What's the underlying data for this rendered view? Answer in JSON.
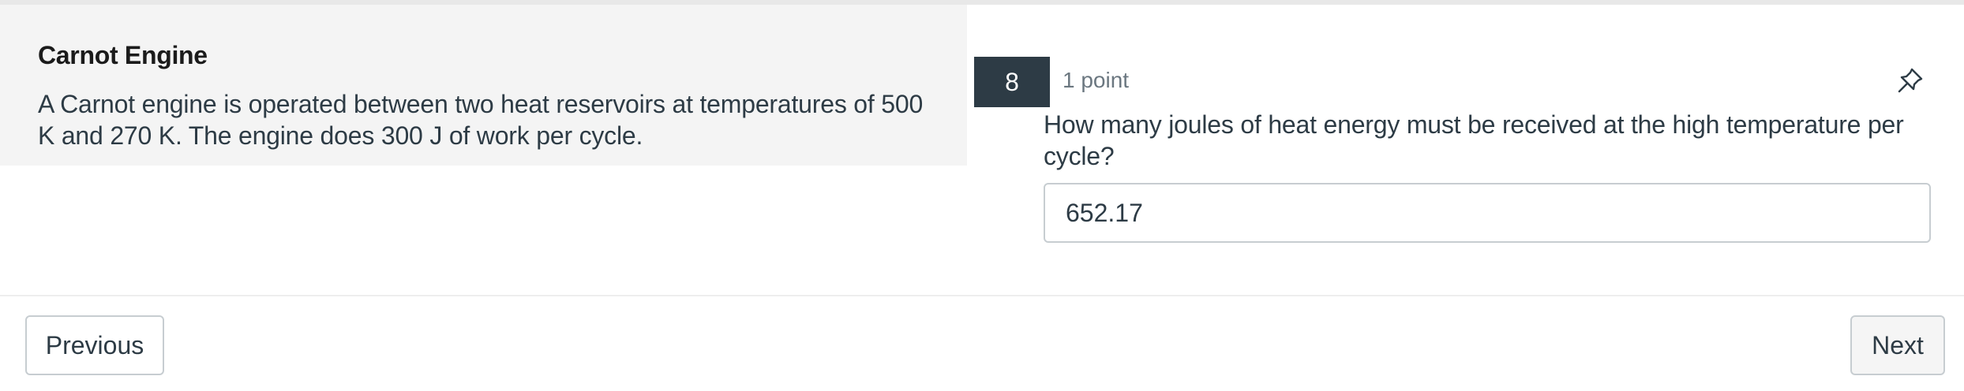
{
  "stimulus": {
    "title": "Carnot Engine",
    "text": "A Carnot engine is operated between two heat reservoirs at temperatures of 500 K and 270 K. The engine does 300 J of work per cycle."
  },
  "question": {
    "number": "8",
    "points": "1 point",
    "text": "How many joules of heat energy must be received at the high temperature per cycle?",
    "answer_value": "652.17",
    "pin_icon": "pin-icon"
  },
  "nav": {
    "previous_label": "Previous",
    "next_label": "Next"
  },
  "colors": {
    "question_number_bg": "#2d3b45",
    "stimulus_bg": "#f4f4f4",
    "text": "#2d3b45"
  }
}
